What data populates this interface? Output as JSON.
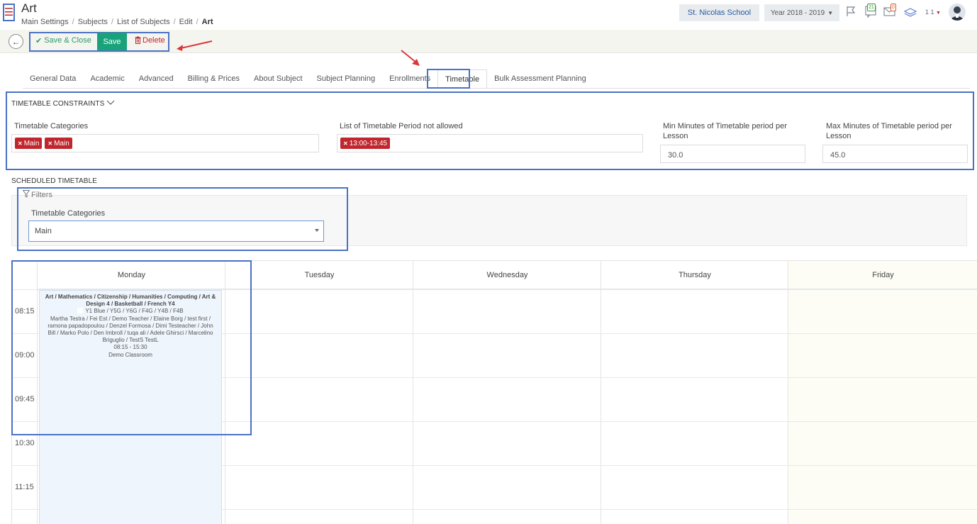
{
  "header": {
    "title": "Art",
    "breadcrumb": [
      "Main Settings",
      "Subjects",
      "List of Subjects",
      "Edit",
      "Art"
    ],
    "school": "St. Nicolas School",
    "year": "Year 2018 - 2019",
    "notifications_count": "21",
    "messages_count": "0",
    "user_short": "1 1"
  },
  "toolbar": {
    "save_close_label": "Save & Close",
    "save_label": "Save",
    "delete_label": "Delete"
  },
  "tabs": [
    {
      "label": "General Data"
    },
    {
      "label": "Academic"
    },
    {
      "label": "Advanced"
    },
    {
      "label": "Billing & Prices"
    },
    {
      "label": "About Subject"
    },
    {
      "label": "Subject Planning"
    },
    {
      "label": "Enrollments"
    },
    {
      "label": "Timetable",
      "active": true
    },
    {
      "label": "Bulk Assessment Planning"
    }
  ],
  "constraints": {
    "section_title": "TIMETABLE CONSTRAINTS",
    "categories_label": "Timetable Categories",
    "categories": [
      "Main",
      "Main"
    ],
    "not_allowed_label": "List of Timetable Period not allowed",
    "not_allowed": [
      "13:00-13:45"
    ],
    "min_label": "Min Minutes of Timetable period per Lesson",
    "min_value": "30.0",
    "max_label": "Max Minutes of Timetable period per Lesson",
    "max_value": "45.0"
  },
  "scheduled": {
    "section_title": "SCHEDULED TIMETABLE",
    "filters_label": "Filters",
    "filter_categories_label": "Timetable Categories",
    "filter_categories_value": "Main"
  },
  "calendar": {
    "days": [
      "Monday",
      "Tuesday",
      "Wednesday",
      "Thursday",
      "Friday"
    ],
    "times": [
      "08:15",
      "09:00",
      "09:45",
      "10:30",
      "11:15"
    ],
    "event": {
      "title": "Art / Mathematics / Citizenship / Humanities / Computing / Art & Design 4 / Basketball / French Y4",
      "groups": "Y1 Blue / Y5G / Y6G / F4G / Y4B / F4B",
      "teachers": "Martha Testra / Fei Est / Demo Teacher / Elaine Borg / test first / ramona papadopoulou / Denzel Formosa / Dimi Testeacher / John Bill / Marko Polo / Den Imbroll / tuqa ali / Adele Ghirsci / Marcelino Briguglio / TestS TestL",
      "time": "08:15 - 15:30",
      "room": "Demo Classroom"
    }
  },
  "colors": {
    "accent_blue": "#4a72c4",
    "save_green": "#1aa37a",
    "danger_red": "#c0262d",
    "event_bg": "#eef5fc"
  }
}
